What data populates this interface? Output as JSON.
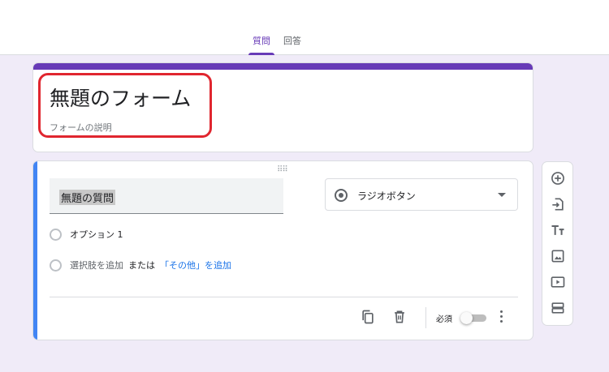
{
  "tabs": [
    {
      "label": "質問",
      "active": true
    },
    {
      "label": "回答",
      "active": false
    }
  ],
  "form": {
    "title": "無題のフォーム",
    "description": "フォームの説明"
  },
  "question": {
    "title": "無題の質問",
    "type": "ラジオボタン",
    "options": [
      "オプション 1"
    ],
    "add_option": "選択肢を追加",
    "or": "または",
    "add_other": "「その他」を追加",
    "required_label": "必須",
    "required": false
  },
  "colors": {
    "brand": "#673ab7",
    "accent": "#4285f4",
    "background": "#f0ebf8",
    "highlight": "#e0262f"
  },
  "icons": {
    "footer": [
      "copy-icon",
      "trash-icon",
      "more-vert-icon"
    ],
    "toolbar": [
      "add-question-icon",
      "import-questions-icon",
      "add-title-icon",
      "add-image-icon",
      "add-video-icon",
      "add-section-icon"
    ]
  }
}
